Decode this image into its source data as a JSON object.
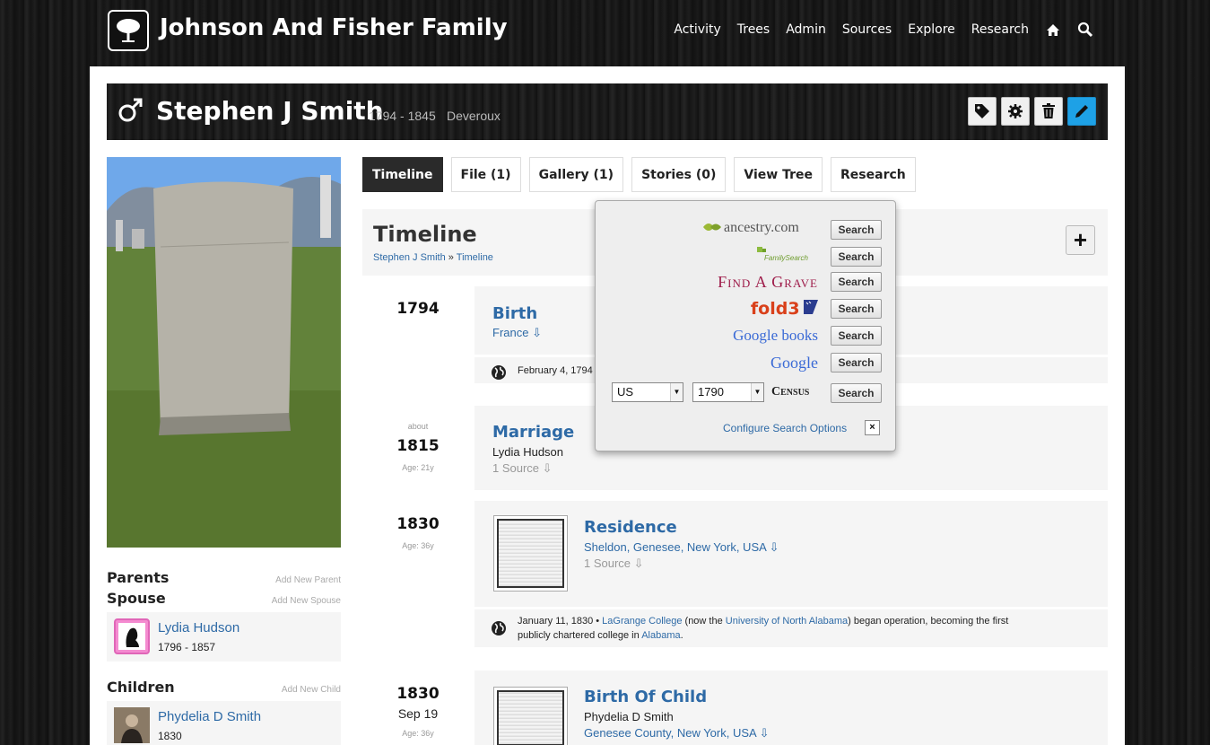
{
  "site": {
    "title": "Johnson And Fisher Family"
  },
  "nav": {
    "items": [
      "Activity",
      "Trees",
      "Admin",
      "Sources",
      "Explore",
      "Research"
    ],
    "home_icon": "home-icon",
    "search_icon": "search-icon"
  },
  "person": {
    "name": "Stephen J Smith",
    "dates": "1794 - 1845",
    "place": "Deveroux",
    "gender_icon": "male-icon"
  },
  "header_actions": [
    "tag-icon",
    "gear-icon",
    "trash-icon",
    "pencil-icon"
  ],
  "tabs": [
    "Timeline",
    "File (1)",
    "Gallery (1)",
    "Stories (0)",
    "View Tree",
    "Research"
  ],
  "timeline": {
    "title": "Timeline",
    "breadcrumb": {
      "person": "Stephen J Smith",
      "sep": "»",
      "page": "Timeline"
    },
    "add_label": "+"
  },
  "events": [
    {
      "year": "1794",
      "title": "Birth",
      "place": "France ⇩",
      "hist_date": "February 4, 1794"
    },
    {
      "prefix": "about",
      "year": "1815",
      "age": "Age: 21y",
      "title": "Marriage",
      "person": "Lydia Hudson",
      "source": "1 Source ⇩"
    },
    {
      "year": "1830",
      "age": "Age: 36y",
      "title": "Residence",
      "place": "Sheldon, Genesee, New York, USA ⇩",
      "source": "1 Source ⇩",
      "hist_date": "January 11, 1830 •",
      "hist_l1": "LaGrange College",
      "hist_t1": "(now the",
      "hist_l2": "University of North Alabama",
      "hist_t2": ") began operation, becoming the first",
      "hist_t3": "publicly chartered college in",
      "hist_l3": "Alabama",
      "hist_t4": "."
    },
    {
      "year": "1830",
      "date": "Sep 19",
      "age": "Age: 36y",
      "title": "Birth Of Child",
      "person": "Phydelia D Smith",
      "place": "Genesee County, New York, USA ⇩"
    }
  ],
  "sidebar": {
    "parents": {
      "heading": "Parents",
      "add": "Add New Parent"
    },
    "spouse": {
      "heading": "Spouse",
      "add": "Add New Spouse",
      "name": "Lydia Hudson",
      "dates": "1796 - 1857"
    },
    "children": {
      "heading": "Children",
      "add": "Add New Child",
      "name": "Phydelia D Smith",
      "dates": "1830"
    }
  },
  "research_popup": {
    "search_label": "Search",
    "providers": [
      "ancestry.com",
      "FamilySearch",
      "Find A Grave",
      "fold3",
      "Google books",
      "Google"
    ],
    "country_value": "US",
    "year_value": "1790",
    "census_label": "Census",
    "configure_label": "Configure Search Options",
    "close_label": "×"
  },
  "colors": {
    "link": "#2e6aa6",
    "edit_button": "#1ea1e6",
    "active_tab": "#2a2a2a"
  }
}
